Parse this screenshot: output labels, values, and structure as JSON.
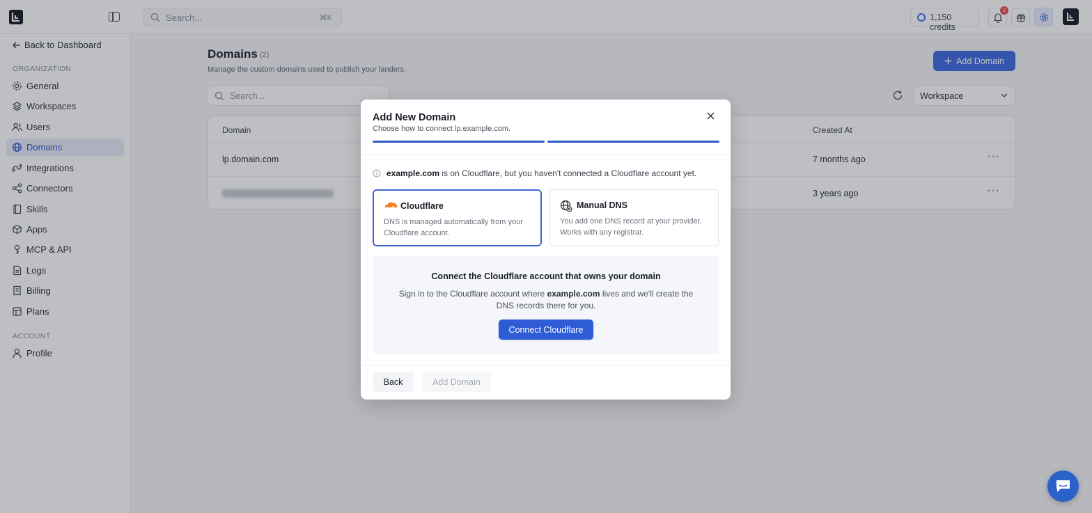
{
  "topbar": {
    "search_placeholder": "Search...",
    "search_shortcut": "⌘K",
    "credits": "1,150 credits",
    "notification_count": "2"
  },
  "sidebar": {
    "back_label": "Back to Dashboard",
    "org_section": "ORGANIZATION",
    "items": [
      {
        "label": "General",
        "icon": "gear-icon"
      },
      {
        "label": "Workspaces",
        "icon": "layers-icon"
      },
      {
        "label": "Users",
        "icon": "users-icon"
      },
      {
        "label": "Domains",
        "icon": "globe-icon",
        "active": true
      },
      {
        "label": "Integrations",
        "icon": "integrations-icon"
      },
      {
        "label": "Connectors",
        "icon": "share-icon"
      },
      {
        "label": "Skills",
        "icon": "book-icon"
      },
      {
        "label": "Apps",
        "icon": "box-icon"
      },
      {
        "label": "MCP & API",
        "icon": "key-icon"
      },
      {
        "label": "Logs",
        "icon": "file-icon"
      },
      {
        "label": "Billing",
        "icon": "receipt-icon"
      },
      {
        "label": "Plans",
        "icon": "plans-icon"
      }
    ],
    "account_section": "ACCOUNT",
    "account_items": [
      {
        "label": "Profile",
        "icon": "user-icon"
      }
    ]
  },
  "main": {
    "title": "Domains",
    "count": "(2)",
    "subtitle": "Manage the custom domains used to publish your landers.",
    "add_button": "Add Domain",
    "search_placeholder": "Search...",
    "workspace_filter": "Workspace",
    "table": {
      "columns": [
        "Domain",
        "Created At"
      ],
      "rows": [
        {
          "domain": "lp.domain.com",
          "created": "7 months ago"
        },
        {
          "domain": "",
          "created": "3 years ago"
        }
      ]
    }
  },
  "modal": {
    "title": "Add New Domain",
    "subtitle": "Choose how to connect lp.example.com.",
    "notice_domain": "example.com",
    "notice_text": " is on Cloudflare, but you haven't connected a Cloudflare account yet.",
    "options": [
      {
        "title": "Cloudflare",
        "desc": "DNS is managed automatically from your Cloudflare account.",
        "selected": true
      },
      {
        "title": "Manual DNS",
        "desc": "You add one DNS record at your provider. Works with any registrar.",
        "selected": false
      }
    ],
    "panel": {
      "title": "Connect the Cloudflare account that owns your domain",
      "desc_prefix": "Sign in to the Cloudflare account where ",
      "desc_domain": "example.com",
      "desc_suffix": " lives and we'll create the DNS records there for you.",
      "button": "Connect Cloudflare"
    },
    "back_button": "Back",
    "add_button": "Add Domain"
  },
  "colors": {
    "accent": "#3b66e0",
    "active_nav_bg": "#e6ebf7",
    "cloudflare_orange": "#f38020"
  }
}
